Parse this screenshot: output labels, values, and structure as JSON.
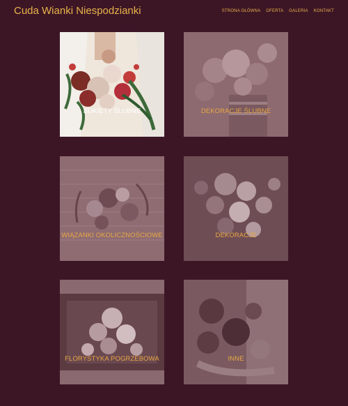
{
  "header": {
    "brand": "Cuda Wianki Niespodzianki",
    "nav": [
      {
        "label": "STRONA GŁÓWNA"
      },
      {
        "label": "OFERTA"
      },
      {
        "label": "GALERIA"
      },
      {
        "label": "KONTAKT"
      }
    ]
  },
  "tiles": [
    {
      "label": "BUKIETY ŚLUBNE"
    },
    {
      "label": "DEKORACJE ŚLUBNE"
    },
    {
      "label": "WIĄZANKI OKOLICZNOŚCIOWE"
    },
    {
      "label": "DEKORACJE"
    },
    {
      "label": "FLORYSTYKA POGRZEBOWA"
    },
    {
      "label": "INNE"
    }
  ],
  "colors": {
    "background": "#3d1626",
    "accent": "#e8b34a",
    "overlay": "#8a5c66"
  }
}
